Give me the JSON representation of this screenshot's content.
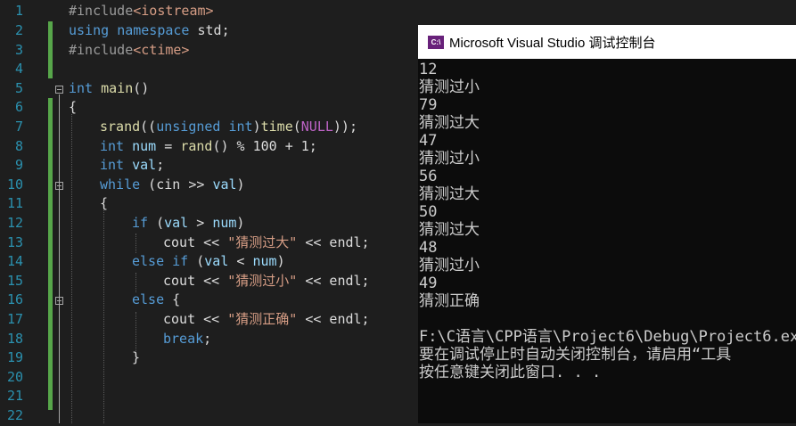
{
  "editor": {
    "line_numbers": [
      "1",
      "2",
      "3",
      "4",
      "5",
      "6",
      "7",
      "8",
      "9",
      "10",
      "11",
      "12",
      "13",
      "14",
      "15",
      "16",
      "17",
      "18",
      "19",
      "20",
      "21",
      "22"
    ],
    "code": {
      "l1_pp": "#include",
      "l1_inc": "<iostream>",
      "l2_kw1": "using",
      "l2_kw2": "namespace",
      "l2_rest": " std;",
      "l3_pp": "#include",
      "l3_inc": "<ctime>",
      "l5_kw": "int",
      "l5_fn": " main",
      "l5_rest": "()",
      "l6": "{",
      "l7_fn": "srand",
      "l7_a": "((",
      "l7_kw": "unsigned int",
      "l7_b": ")",
      "l7_fn2": "time",
      "l7_c": "(",
      "l7_macro": "NULL",
      "l7_d": "));",
      "l8_kw": "int",
      "l8_var": " num",
      "l8_a": " = ",
      "l8_fn": "rand",
      "l8_b": "() % 100 + 1;",
      "l9_kw": "int",
      "l9_var": " val",
      "l9_rest": ";",
      "l10_kw": "while",
      "l10_a": " (cin >> ",
      "l10_var": "val",
      "l10_b": ")",
      "l11": "{",
      "l12_kw": "if",
      "l12_a": " (",
      "l12_var": "val",
      "l12_b": " > ",
      "l12_var2": "num",
      "l12_c": ")",
      "l13_a": "cout << ",
      "l13_str": "\"猜测过大\"",
      "l13_b": " << endl;",
      "l14_kw": "else if",
      "l14_a": " (",
      "l14_var": "val",
      "l14_b": " < ",
      "l14_var2": "num",
      "l14_c": ")",
      "l15_a": "cout << ",
      "l15_str": "\"猜测过小\"",
      "l15_b": " << endl;",
      "l16_kw": "else",
      "l16_rest": " {",
      "l17_a": "cout << ",
      "l17_str": "\"猜测正确\"",
      "l17_b": " << endl;",
      "l18_kw": "break",
      "l18_rest": ";",
      "l19": "}"
    }
  },
  "console": {
    "title": "Microsoft Visual Studio 调试控制台",
    "icon_label": "C:\\",
    "lines": [
      "12",
      "猜测过小",
      "79",
      "猜测过大",
      "47",
      "猜测过小",
      "56",
      "猜测过大",
      "50",
      "猜测过大",
      "48",
      "猜测过小",
      "49",
      "猜测正确",
      "",
      "F:\\C语言\\CPP语言\\Project6\\Debug\\Project6.ex",
      "要在调试停止时自动关闭控制台，请启用“工具",
      "按任意键关闭此窗口. . ."
    ]
  },
  "colors": {
    "editor_bg": "#1e1e1e",
    "line_number": "#2b91af",
    "keyword": "#569cd6",
    "string": "#d69d85",
    "change_bar": "#57a64a",
    "console_bg": "#0c0c0c",
    "console_text": "#cccccc"
  }
}
